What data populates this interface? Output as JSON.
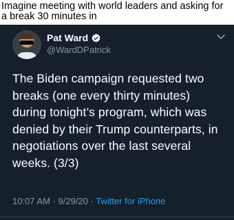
{
  "caption": {
    "line1": "Imagine meeting with world leaders and asking for",
    "line2": "a break 30 minutes in"
  },
  "tweet": {
    "display_name": "Pat Ward",
    "handle": "@WardDPatrick",
    "verified": true,
    "body_lines": [
      "The Biden campaign requested two",
      "breaks (one every thirty minutes)",
      "during tonight’s program, which was",
      "denied by their Trump counterparts, in",
      "negotiations over the last several",
      "weeks. (3/3)"
    ],
    "time": "10:07 AM",
    "separator": "·",
    "date": "9/29/20",
    "source": "Twitter for iPhone",
    "icons": {
      "verified": "verified-badge-icon",
      "more": "chevron-down-icon"
    },
    "colors": {
      "background": "#15202b",
      "text": "#ffffff",
      "muted": "#8899a6",
      "accent": "#1da1f2"
    }
  }
}
